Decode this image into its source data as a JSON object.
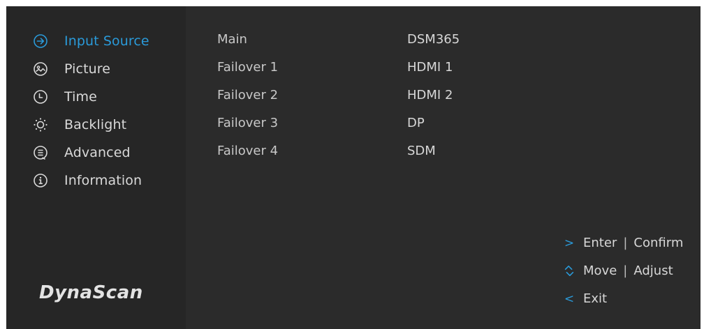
{
  "menu": {
    "items": [
      {
        "label": "Input Source",
        "icon": "arrow-circle-right-icon"
      },
      {
        "label": "Picture",
        "icon": "picture-icon"
      },
      {
        "label": "Time",
        "icon": "clock-icon"
      },
      {
        "label": "Backlight",
        "icon": "sun-icon"
      },
      {
        "label": "Advanced",
        "icon": "list-circle-icon"
      },
      {
        "label": "Information",
        "icon": "info-icon"
      }
    ],
    "active_index": 0
  },
  "input_source": {
    "rows": [
      {
        "label": "Main",
        "value": "DSM365"
      },
      {
        "label": "Failover 1",
        "value": "HDMI 1"
      },
      {
        "label": "Failover 2",
        "value": "HDMI 2"
      },
      {
        "label": "Failover 3",
        "value": "DP"
      },
      {
        "label": "Failover 4",
        "value": "SDM"
      }
    ]
  },
  "brand": {
    "name": "DynaScan"
  },
  "hints": {
    "enter": {
      "icon": "chevron-right-icon",
      "text1": "Enter",
      "text2": "Confirm"
    },
    "move": {
      "icon": "up-down-chevron-icon",
      "text1": "Move",
      "text2": "Adjust"
    },
    "exit": {
      "icon": "chevron-left-icon",
      "text1": "Exit"
    }
  },
  "colors": {
    "accent": "#2a9ad9",
    "background": "#2b2b2b",
    "sidebar": "#262626",
    "text": "#d7d7d7"
  }
}
